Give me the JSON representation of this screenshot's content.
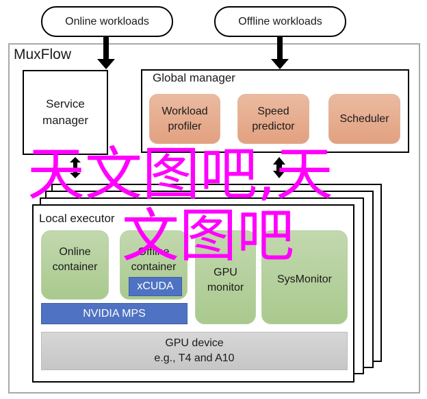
{
  "inputs": {
    "online_workloads": "Online workloads",
    "offline_workloads": "Offline workloads"
  },
  "system": {
    "title": "MuxFlow",
    "service_manager": "Service\nmanager",
    "global_manager": {
      "title": "Global manager",
      "components": [
        "Workload\nprofiler",
        "Speed\npredictor",
        "Scheduler"
      ]
    },
    "local_executor": {
      "title": "Local executor",
      "online_container": "Online\ncontainer",
      "offline_container": "Offline\ncontainer",
      "xcuda": "xCUDA",
      "nvidia_mps": "NVIDIA MPS",
      "gpu_monitor": "GPU\nmonitor",
      "sys_monitor": "SysMonitor",
      "gpu_device_line1": "GPU device",
      "gpu_device_line2": "e.g., T4 and A10"
    }
  },
  "watermark": {
    "line1": "天文图吧,天",
    "line2": "文图吧",
    "color": "#ff00ff"
  },
  "colors": {
    "orange_component": "#e6aa8a",
    "green_component": "#b4d09c",
    "blue_layer": "#4f72c2",
    "gray_device": "#cfcfcf",
    "outer_border": "#a9a9a9"
  }
}
